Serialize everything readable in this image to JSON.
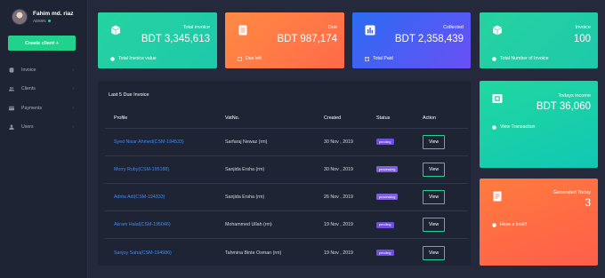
{
  "profile": {
    "name": "Fahim md. riaz",
    "role": "ADMIN"
  },
  "sidebar": {
    "create_label": "Create client +",
    "items": [
      {
        "label": "Invoice",
        "icon": "database-icon"
      },
      {
        "label": "Clients",
        "icon": "users-icon"
      },
      {
        "label": "Payments",
        "icon": "card-icon"
      },
      {
        "label": "Users",
        "icon": "user-icon"
      }
    ]
  },
  "cards": {
    "total_invoice": {
      "title": "Total invoice",
      "value": "BDT 3,345,613",
      "footer": "Total Invoice value",
      "color": "#25d3a0"
    },
    "due": {
      "title": "Due",
      "value": "BDT 987,174",
      "footer": "Due left",
      "color": "#ff7a45"
    },
    "collected": {
      "title": "Collected",
      "value": "BDT 2,358,439",
      "footer": "Total Paid",
      "color": "#3f63f3"
    },
    "invoice_count": {
      "title": "Invoice",
      "value": "100",
      "footer": "Total Number of Invoice",
      "color": "#25d3a0"
    },
    "income": {
      "title": "Todays income",
      "value": "BDT 36,060",
      "footer": "View Transaction",
      "color": "#1fd8a0"
    },
    "generated": {
      "title": "Generated Today",
      "value": "3",
      "footer": "Have a look!!",
      "color": "#ff6a44"
    }
  },
  "table": {
    "title": "Last 5 Due Invoice",
    "columns": [
      "Profile",
      "VatNo.",
      "Created",
      "Status",
      "Action"
    ],
    "rows": [
      {
        "profile": "Syed Nisar Ahmed(CSM-194533)",
        "vat": "Sarfaraj Newaz (rm)",
        "created": "30 Nov , 2019",
        "status": "pending",
        "action": "View"
      },
      {
        "profile": "Morry Ruby(CSM-195188)",
        "vat": "Sanjida Ersha (rm)",
        "created": "30 Nov , 2019",
        "status": "processing",
        "action": "View"
      },
      {
        "profile": "Adrita Adi(CSM-194333)",
        "vat": "Sanjida Ersha (rm)",
        "created": "26 Nov , 2019",
        "status": "processing",
        "action": "View"
      },
      {
        "profile": "Akram Halal(CSM-195046)",
        "vat": "Mohammed Ullah (rm)",
        "created": "19 Nov , 2019",
        "status": "pending",
        "action": "View"
      },
      {
        "profile": "Sanjoy Saha(CSM-194986)",
        "vat": "Tahmina Binte Osman (rm)",
        "created": "19 Nov , 2019",
        "status": "pending",
        "action": "View"
      }
    ]
  }
}
